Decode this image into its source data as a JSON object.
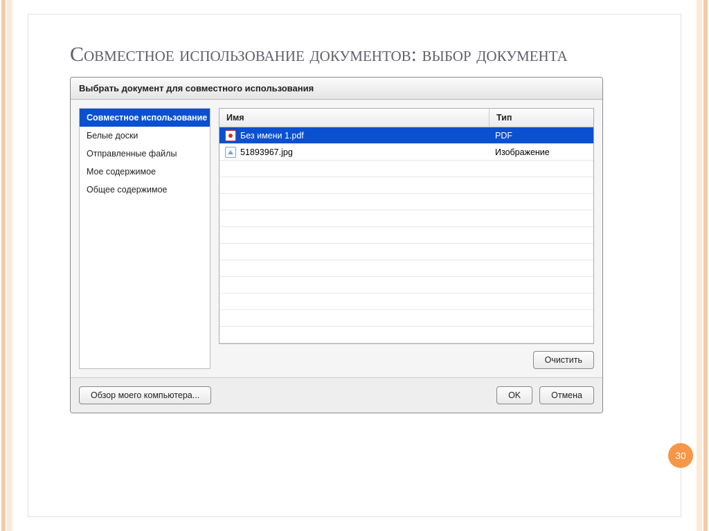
{
  "slide": {
    "title": "Совместное использование документов: выбор документа",
    "page_number": "30"
  },
  "dialog": {
    "title": "Выбрать документ для совместного использования",
    "sidebar": {
      "items": [
        {
          "label": "Совместное использование",
          "selected": true
        },
        {
          "label": "Белые доски",
          "selected": false
        },
        {
          "label": "Отправленные файлы",
          "selected": false
        },
        {
          "label": "Мое содержимое",
          "selected": false
        },
        {
          "label": "Общее содержимое",
          "selected": false
        }
      ]
    },
    "grid": {
      "columns": {
        "name": "Имя",
        "type": "Тип"
      },
      "rows": [
        {
          "name": "Без имени 1.pdf",
          "type": "PDF",
          "icon": "pdf",
          "selected": true
        },
        {
          "name": "51893967.jpg",
          "type": "Изображение",
          "icon": "img",
          "selected": false
        }
      ],
      "empty_rows": 11
    },
    "buttons": {
      "clear": "Очистить",
      "browse": "Обзор моего компьютера...",
      "ok": "OK",
      "cancel": "Отмена"
    }
  }
}
